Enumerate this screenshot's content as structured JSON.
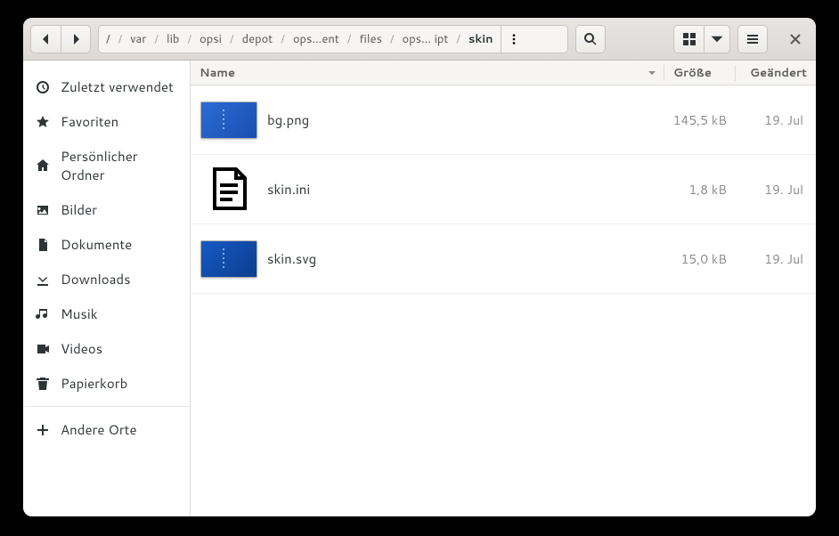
{
  "breadcrumbs": [
    "/",
    "var",
    "lib",
    "opsi",
    "depot",
    "ops…ent",
    "files",
    "ops… ipt",
    "skin"
  ],
  "columns": {
    "name": "Name",
    "size": "Größe",
    "modified": "Geändert"
  },
  "sidebar": [
    {
      "id": "recent",
      "label": "Zuletzt verwendet"
    },
    {
      "id": "starred",
      "label": "Favoriten"
    },
    {
      "id": "home",
      "label": "Persönlicher Ordner"
    },
    {
      "id": "pictures",
      "label": "Bilder"
    },
    {
      "id": "documents",
      "label": "Dokumente"
    },
    {
      "id": "downloads",
      "label": "Downloads"
    },
    {
      "id": "music",
      "label": "Musik"
    },
    {
      "id": "videos",
      "label": "Videos"
    },
    {
      "id": "trash",
      "label": "Papierkorb"
    }
  ],
  "other_locations": "Andere Orte",
  "files": [
    {
      "name": "bg.png",
      "size": "145,5 kB",
      "modified": "19. Jul",
      "kind": "image"
    },
    {
      "name": "skin.ini",
      "size": "1,8 kB",
      "modified": "19. Jul",
      "kind": "text"
    },
    {
      "name": "skin.svg",
      "size": "15,0 kB",
      "modified": "19. Jul",
      "kind": "image-svg"
    }
  ]
}
